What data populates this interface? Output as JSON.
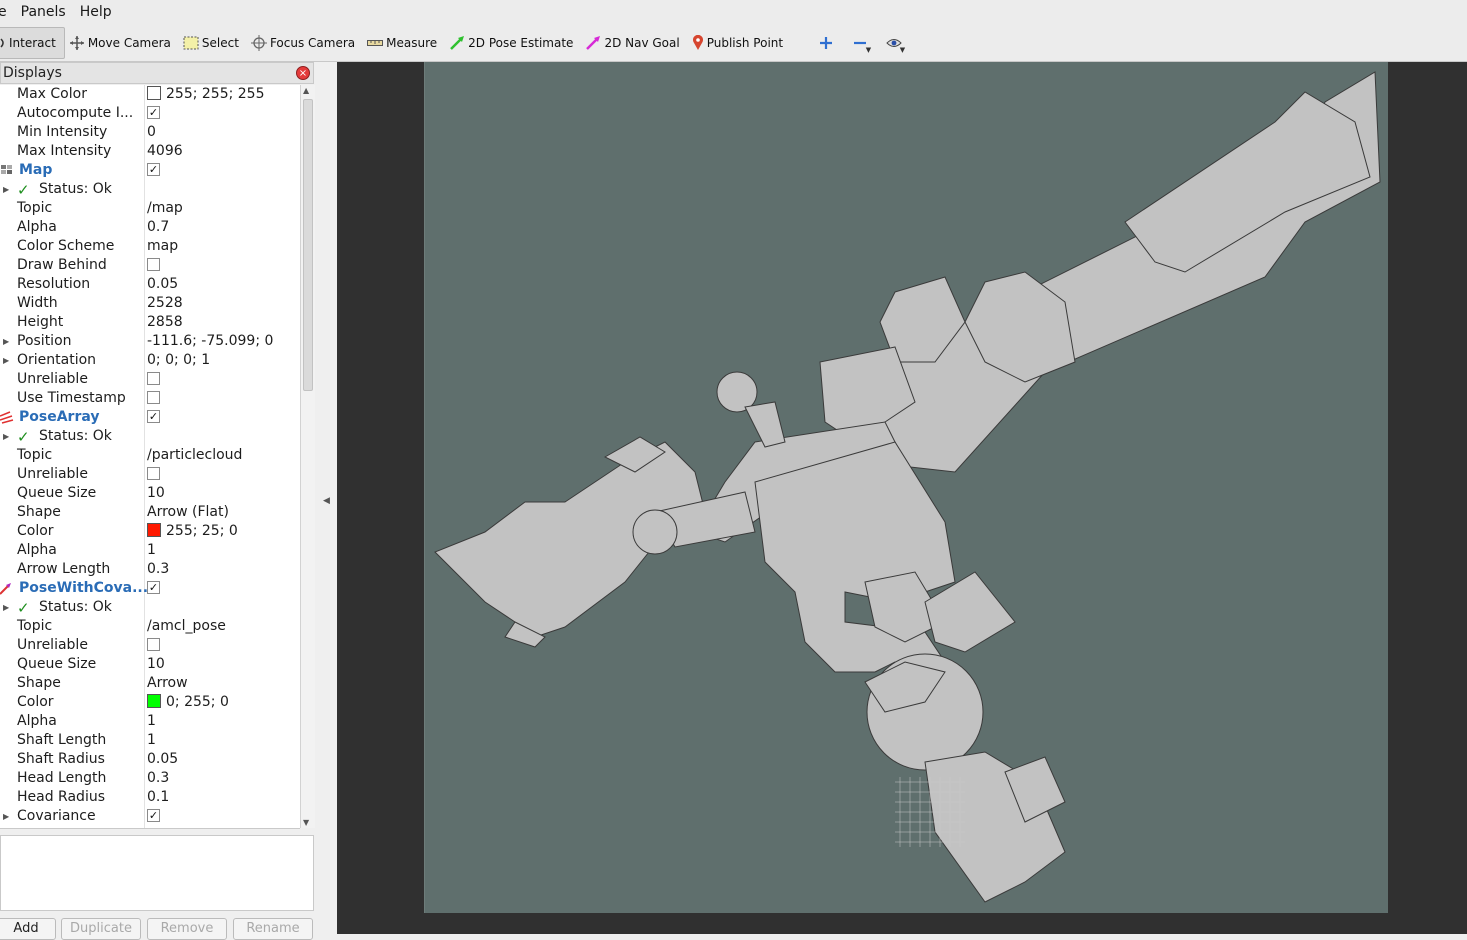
{
  "menubar": {
    "items": [
      "e",
      "Panels",
      "Help"
    ]
  },
  "toolbar": {
    "tools": [
      {
        "label": "Interact",
        "icon": "interact-icon"
      },
      {
        "label": "Move Camera",
        "icon": "move-camera-icon"
      },
      {
        "label": "Select",
        "icon": "select-icon"
      },
      {
        "label": "Focus Camera",
        "icon": "focus-camera-icon"
      },
      {
        "label": "Measure",
        "icon": "measure-icon"
      },
      {
        "label": "2D Pose Estimate",
        "icon": "pose-estimate-icon"
      },
      {
        "label": "2D Nav Goal",
        "icon": "nav-goal-icon"
      },
      {
        "label": "Publish Point",
        "icon": "publish-point-icon"
      }
    ]
  },
  "displays": {
    "title": "Displays",
    "rows": [
      {
        "key": "Max Color",
        "value": "255; 255; 255",
        "swatch": "#ffffff"
      },
      {
        "key": "Autocompute I...",
        "check": true
      },
      {
        "key": "Min Intensity",
        "value": "0"
      },
      {
        "key": "Max Intensity",
        "value": "4096"
      },
      {
        "key": "Map",
        "check": true,
        "top": true,
        "icon": "map-display-icon"
      },
      {
        "key": "Status: Ok",
        "status": true
      },
      {
        "key": "Topic",
        "value": "/map"
      },
      {
        "key": "Alpha",
        "value": "0.7"
      },
      {
        "key": "Color Scheme",
        "value": "map"
      },
      {
        "key": "Draw Behind",
        "check": false
      },
      {
        "key": "Resolution",
        "value": "0.05"
      },
      {
        "key": "Width",
        "value": "2528"
      },
      {
        "key": "Height",
        "value": "2858"
      },
      {
        "key": "Position",
        "value": "-111.6; -75.099; 0",
        "expander": true
      },
      {
        "key": "Orientation",
        "value": "0; 0; 0; 1",
        "expander": true
      },
      {
        "key": "Unreliable",
        "check": false
      },
      {
        "key": "Use Timestamp",
        "check": false
      },
      {
        "key": "PoseArray",
        "check": true,
        "top": true,
        "icon": "pose-array-icon"
      },
      {
        "key": "Status: Ok",
        "status": true
      },
      {
        "key": "Topic",
        "value": "/particlecloud"
      },
      {
        "key": "Unreliable",
        "check": false
      },
      {
        "key": "Queue Size",
        "value": "10"
      },
      {
        "key": "Shape",
        "value": "Arrow (Flat)"
      },
      {
        "key": "Color",
        "value": "255; 25; 0",
        "swatch": "#ff1900"
      },
      {
        "key": "Alpha",
        "value": "1"
      },
      {
        "key": "Arrow Length",
        "value": "0.3"
      },
      {
        "key": "PoseWithCova...",
        "check": true,
        "top": true,
        "icon": "pose-covariance-icon"
      },
      {
        "key": "Status: Ok",
        "status": true
      },
      {
        "key": "Topic",
        "value": "/amcl_pose"
      },
      {
        "key": "Unreliable",
        "check": false
      },
      {
        "key": "Queue Size",
        "value": "10"
      },
      {
        "key": "Shape",
        "value": "Arrow"
      },
      {
        "key": "Color",
        "value": "0; 255; 0",
        "swatch": "#00ff00"
      },
      {
        "key": "Alpha",
        "value": "1"
      },
      {
        "key": "Shaft Length",
        "value": "1"
      },
      {
        "key": "Shaft Radius",
        "value": "0.05"
      },
      {
        "key": "Head Length",
        "value": "0.3"
      },
      {
        "key": "Head Radius",
        "value": "0.1"
      },
      {
        "key": "Covariance",
        "check": true,
        "expander": true
      }
    ]
  },
  "buttons": {
    "add": "Add",
    "duplicate": "Duplicate",
    "remove": "Remove",
    "rename": "Rename"
  },
  "colors": {
    "map_background": "#5f6f6d",
    "free_space": "#c2c2c2",
    "viewport": "#303030"
  }
}
